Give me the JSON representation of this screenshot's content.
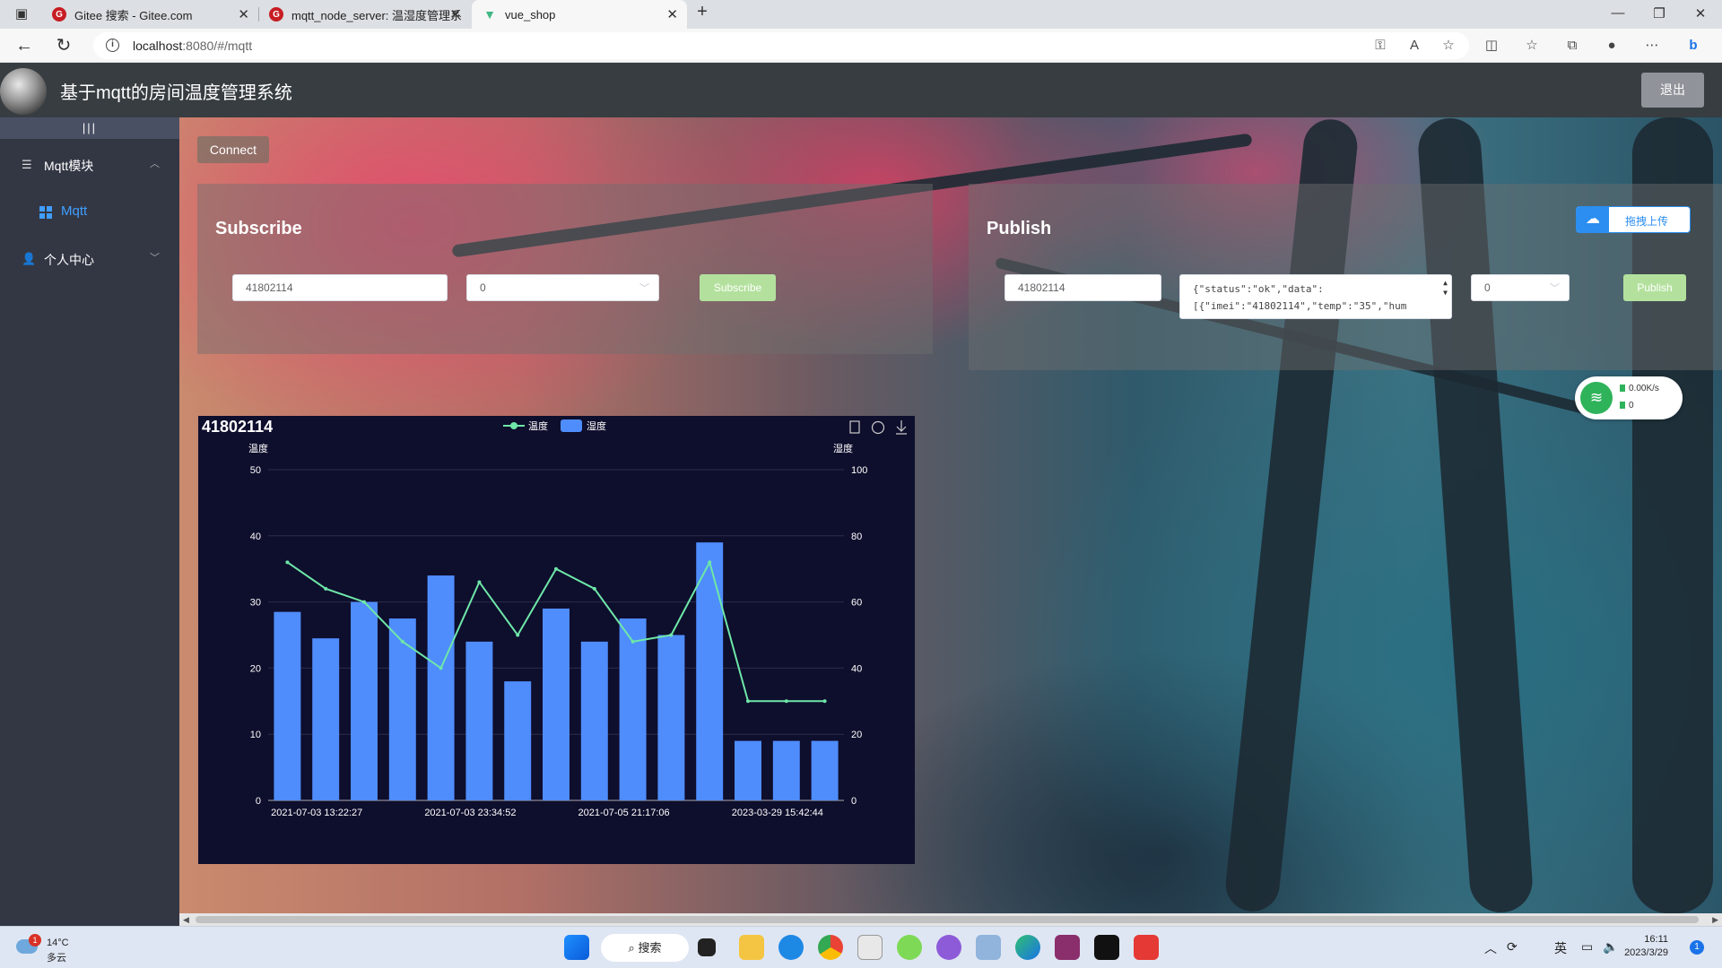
{
  "browser": {
    "tabs": [
      {
        "title": "Gitee 搜索 - Gitee.com",
        "active": false
      },
      {
        "title": "mqtt_node_server: 温湿度管理系",
        "active": false
      },
      {
        "title": "vue_shop",
        "active": true
      }
    ],
    "new_tab_label": "+",
    "url_host": "localhost",
    "url_rest": ":8080/#/mqtt"
  },
  "app": {
    "title": "基于mqtt的房间温度管理系统",
    "logout_label": "退出"
  },
  "sidebar": {
    "toggle_label": "|||",
    "items": [
      {
        "label": "Mqtt模块",
        "expanded": true,
        "children": [
          {
            "label": "Mqtt",
            "active": true
          }
        ]
      },
      {
        "label": "个人中心",
        "expanded": false
      }
    ]
  },
  "connect": {
    "label": "Connect"
  },
  "subscribe": {
    "title": "Subscribe",
    "topic": "41802114",
    "qos": "0",
    "button_label": "Subscribe"
  },
  "publish": {
    "title": "Publish",
    "topic": "41802114",
    "payload_line1": "{\"status\":\"ok\",\"data\":",
    "payload_line2": "[{\"imei\":\"41802114\",\"temp\":\"35\",\"hum",
    "qos": "0",
    "button_label": "Publish"
  },
  "upload": {
    "label": "拖拽上传"
  },
  "net_widget": {
    "speed": "0.00K/s",
    "count": "0"
  },
  "chart_data": {
    "type": "bar",
    "title": "41802114",
    "legend": [
      {
        "name": "温度",
        "type": "line",
        "color": "#6ee7a8"
      },
      {
        "name": "湿度",
        "type": "bar",
        "color": "#4f8dfd"
      }
    ],
    "left_axis_label": "温度",
    "right_axis_label": "湿度",
    "left_ylim": [
      0,
      50
    ],
    "left_ticks": [
      0,
      10,
      20,
      30,
      40,
      50
    ],
    "right_ylim": [
      0,
      100
    ],
    "right_ticks": [
      0,
      20,
      40,
      60,
      80,
      100
    ],
    "x_tick_labels": [
      "2021-07-03 13:22:27",
      "2021-07-03 23:34:52",
      "2021-07-05 21:17:06",
      "2023-03-29 15:42:44"
    ],
    "series": [
      {
        "name": "湿度",
        "axis": "left",
        "type": "bar",
        "values": [
          28.5,
          24.5,
          30,
          27.5,
          34,
          24,
          18,
          29,
          24,
          27.5,
          25,
          39,
          9,
          9,
          9
        ]
      },
      {
        "name": "温度",
        "axis": "right",
        "type": "line",
        "values": [
          72,
          64,
          60,
          48,
          40,
          66,
          50,
          70,
          64,
          48,
          50,
          72,
          30,
          30,
          30
        ]
      }
    ],
    "colors": {
      "background": "#0e0e2d",
      "bar": "#4f8dfd",
      "line": "#6ee7a8",
      "grid": "#2d2d4d",
      "text": "#ffffff"
    }
  },
  "taskbar": {
    "weather_temp": "14°C",
    "weather_desc": "多云",
    "weather_badge": "1",
    "search_label": "搜索",
    "ime": "英",
    "time": "16:11",
    "date": "2023/3/29",
    "notif_count": "1"
  }
}
